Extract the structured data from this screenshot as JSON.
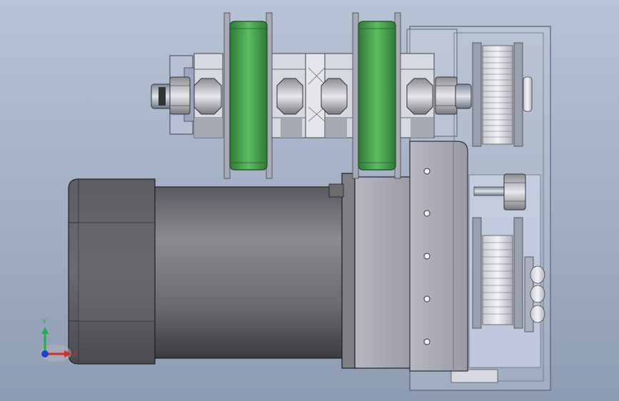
{
  "viewport": {
    "background_top": "#b7c3d6",
    "background_bottom": "#8e9cb3"
  },
  "triad": {
    "y_label": "Y",
    "x_label": "X",
    "y_color": "#22b04b",
    "x_color": "#d22c2c",
    "z_color": "#2040d0"
  },
  "colors": {
    "wheel_green": "#3f9a46",
    "wheel_green_light": "#5cbd61",
    "motor_dark": "#4a4a4f",
    "motor_mid": "#76767c",
    "plate_gray": "#a7a7b3",
    "nut_gray": "#c9c9cf"
  }
}
